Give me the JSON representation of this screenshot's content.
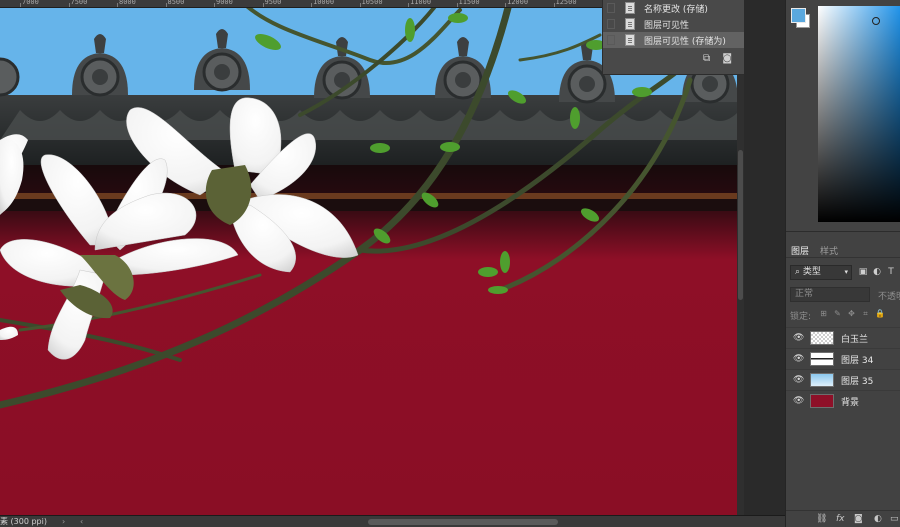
{
  "ruler": {
    "ticks": [
      "7000",
      "7500",
      "8000",
      "8500",
      "9000",
      "9500",
      "10000",
      "10500",
      "11000",
      "11500",
      "12000",
      "12500"
    ]
  },
  "history": {
    "items": [
      {
        "label": "名称更改 (存储)",
        "selected": false
      },
      {
        "label": "图层可见性",
        "selected": false
      },
      {
        "label": "图层可见性 (存储为)",
        "selected": true
      }
    ],
    "tools": [
      {
        "icon": "new-document-from-state-icon",
        "glyph": "⧉"
      },
      {
        "icon": "camera-snapshot-icon",
        "glyph": "◙"
      },
      {
        "icon": "trash-icon",
        "glyph": "🗑"
      }
    ]
  },
  "color": {
    "foreground": "#5aa8de",
    "background": "#ffffff"
  },
  "layers": {
    "tabs": [
      "图层",
      "样式"
    ],
    "filter": {
      "value": "类型"
    },
    "blend_mode": "正常",
    "opacity_label": "不透明",
    "lock_label": "锁定:",
    "items": [
      {
        "name": "白玉兰",
        "thumb": "checker"
      },
      {
        "name": "图层 34",
        "thumb": "stripe"
      },
      {
        "name": "图层 35",
        "thumb": "sky"
      },
      {
        "name": "背景",
        "thumb": "#8e1028"
      }
    ]
  },
  "status": {
    "doc_info": "素 (300 ppi)"
  },
  "colors": {
    "wall_red": "#8e0f27",
    "sky_blue": "#66b4ea",
    "roof_dark": "#2c2f30"
  }
}
